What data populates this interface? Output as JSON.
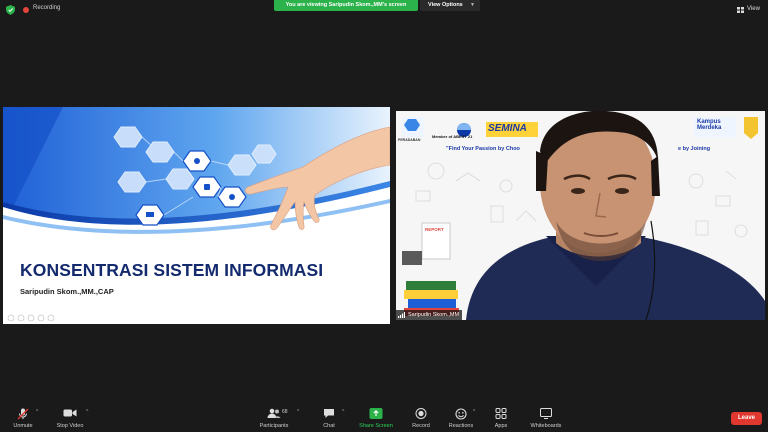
{
  "topbar": {
    "recording_label": "Recording",
    "share_banner": "You are viewing Saripudin Skom.,MM's screen",
    "view_options_label": "View Options",
    "view_label": "View"
  },
  "slide": {
    "title": "KONSENTRASI SISTEM INFORMASI",
    "author": "Saripudin Skom.,MM.,CAP"
  },
  "video": {
    "participant_name": "Saripudin Skom.,MM",
    "banner_seminar": "SEMINA",
    "banner_member": "Member of ABEST 21",
    "banner_tagline": "\"Find Your Passion by Choo",
    "banner_tagline_tail": "e by Joining",
    "banner_kampus": "Kampus Merdeka",
    "banner_report": "REPORT"
  },
  "toolbar": {
    "unmute": "Unmute",
    "stop_video": "Stop Video",
    "participants": "Participants",
    "participants_count": "68",
    "chat": "Chat",
    "share_screen": "Share Screen",
    "record": "Record",
    "reactions": "Reactions",
    "apps": "Apps",
    "whiteboards": "Whiteboards",
    "leave": "Leave"
  },
  "colors": {
    "background": "#1a1a1a",
    "share_green": "#2bb24a",
    "leave_red": "#e0372f",
    "slide_title": "#142a6e"
  }
}
